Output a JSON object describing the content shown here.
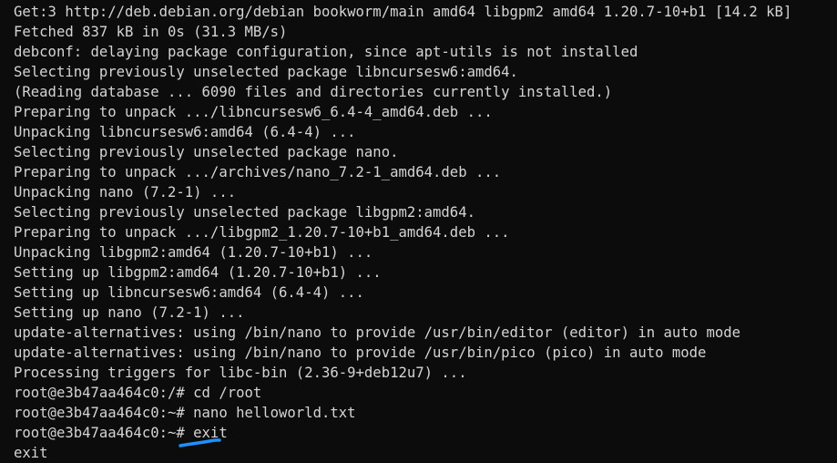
{
  "terminal": {
    "lines": [
      "Get:3 http://deb.debian.org/debian bookworm/main amd64 libgpm2 amd64 1.20.7-10+b1 [14.2 kB]",
      "Fetched 837 kB in 0s (31.3 MB/s)",
      "debconf: delaying package configuration, since apt-utils is not installed",
      "Selecting previously unselected package libncursesw6:amd64.",
      "(Reading database ... 6090 files and directories currently installed.)",
      "Preparing to unpack .../libncursesw6_6.4-4_amd64.deb ...",
      "Unpacking libncursesw6:amd64 (6.4-4) ...",
      "Selecting previously unselected package nano.",
      "Preparing to unpack .../archives/nano_7.2-1_amd64.deb ...",
      "Unpacking nano (7.2-1) ...",
      "Selecting previously unselected package libgpm2:amd64.",
      "Preparing to unpack .../libgpm2_1.20.7-10+b1_amd64.deb ...",
      "Unpacking libgpm2:amd64 (1.20.7-10+b1) ...",
      "Setting up libgpm2:amd64 (1.20.7-10+b1) ...",
      "Setting up libncursesw6:amd64 (6.4-4) ...",
      "Setting up nano (7.2-1) ...",
      "update-alternatives: using /bin/nano to provide /usr/bin/editor (editor) in auto mode",
      "update-alternatives: using /bin/nano to provide /usr/bin/pico (pico) in auto mode",
      "Processing triggers for libc-bin (2.36-9+deb12u7) ...",
      "root@e3b47aa464c0:/# cd /root",
      "root@e3b47aa464c0:~# nano helloworld.txt"
    ],
    "last_prompt": "root@e3b47aa464c0:~# ",
    "last_command": "exit",
    "final_output": "exit",
    "annotation_color": "#1e90ff"
  }
}
